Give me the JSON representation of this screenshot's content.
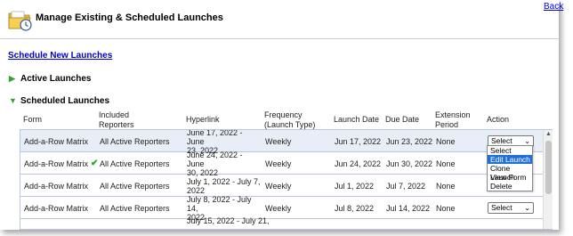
{
  "header": {
    "title": "Manage Existing & Scheduled Launches",
    "back_label": "Back"
  },
  "links": {
    "schedule_new": "Schedule New Launches"
  },
  "sections": {
    "active": "Active Launches",
    "scheduled": "Scheduled Launches"
  },
  "columns": {
    "form": "Form",
    "included_1": "Included",
    "included_2": "Reporters",
    "hyperlink": "Hyperlink",
    "frequency_1": "Frequency",
    "frequency_2": "(Launch Type)",
    "launch_date": "Launch Date",
    "due_date": "Due Date",
    "extension_1": "Extension",
    "extension_2": "Period",
    "action": "Action"
  },
  "rows": [
    {
      "form": "Add-a-Row Matrix",
      "reporters": "All Active Reporters",
      "hyperlink_1": "June 17, 2022 - June",
      "hyperlink_2": "23, 2022",
      "frequency": "Weekly",
      "launch_date": "Jun 17, 2022",
      "due_date": "Jun 23, 2022",
      "extension": "None",
      "action": "Select"
    },
    {
      "form": "Add-a-Row Matrix",
      "reporters": "All Active Reporters",
      "hyperlink_1": "June 24, 2022 - June",
      "hyperlink_2": "30, 2022",
      "frequency": "Weekly",
      "launch_date": "Jun 24, 2022",
      "due_date": "Jun 30, 2022",
      "extension": "None",
      "action": "Select"
    },
    {
      "form": "Add-a-Row Matrix",
      "reporters": "All Active Reporters",
      "hyperlink_1": "July 1, 2022 - July 7,",
      "hyperlink_2": "2022",
      "frequency": "Weekly",
      "launch_date": "Jul 1, 2022",
      "due_date": "Jul 7, 2022",
      "extension": "None",
      "action": "Select"
    },
    {
      "form": "Add-a-Row Matrix",
      "reporters": "All Active Reporters",
      "hyperlink_1": "July 8, 2022 - July 14,",
      "hyperlink_2": "2022",
      "frequency": "Weekly",
      "launch_date": "Jul 8, 2022",
      "due_date": "Jul 14, 2022",
      "extension": "None",
      "action": "Select"
    },
    {
      "form": "",
      "reporters": "",
      "hyperlink_1": "July 15, 2022 - July 21,",
      "hyperlink_2": "",
      "frequency": "",
      "launch_date": "",
      "due_date": "",
      "extension": "",
      "action": ""
    }
  ],
  "dropdown": {
    "options": [
      "Select",
      "Edit Launch",
      "Clone Launch",
      "View Form",
      "Delete"
    ],
    "highlighted": "Edit Launch"
  },
  "colors": {
    "link": "#0000cc",
    "accent_green": "#2ea62e",
    "row_selected": "#e8eef8",
    "highlight": "#1e6fd9"
  },
  "icons": {
    "header": "folder-icon",
    "row2_status": "checkmark-icon"
  }
}
